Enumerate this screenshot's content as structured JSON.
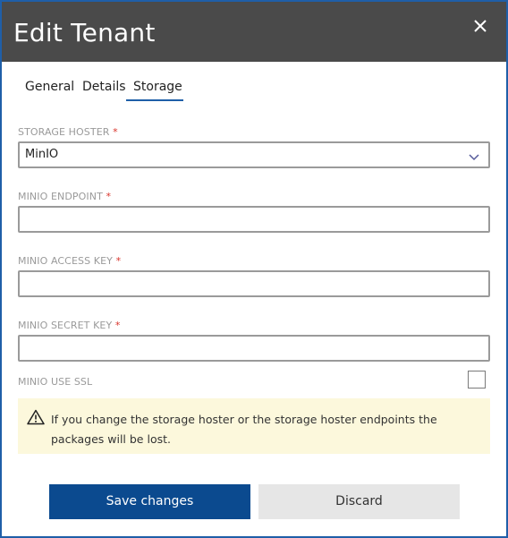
{
  "dialog": {
    "title": "Edit Tenant",
    "close_icon": "close-icon"
  },
  "tabs": [
    {
      "label": "General",
      "active": false
    },
    {
      "label": "Details",
      "active": false
    },
    {
      "label": "Storage",
      "active": true
    }
  ],
  "form": {
    "storage_hoster": {
      "label": "STORAGE HOSTER",
      "required_mark": "*",
      "value": "MinIO"
    },
    "minio_endpoint": {
      "label": "MINIO ENDPOINT",
      "required_mark": "*",
      "value": ""
    },
    "minio_access_key": {
      "label": "MINIO ACCESS KEY",
      "required_mark": "*",
      "value": ""
    },
    "minio_secret_key": {
      "label": "MINIO SECRET KEY",
      "required_mark": "*",
      "value": ""
    },
    "minio_use_ssl": {
      "label": "MINIO USE SSL",
      "checked": false
    }
  },
  "warning": {
    "icon": "warning-icon",
    "text": "If you change the storage hoster or the storage hoster endpoints the packages will be lost."
  },
  "buttons": {
    "save_label": "Save changes",
    "discard_label": "Discard"
  },
  "colors": {
    "accent": "#1f5fa8",
    "header_bg": "#4a4a4a",
    "primary_button": "#0b4a8f",
    "warning_bg": "#fcf8dc",
    "required": "#d9342b"
  }
}
